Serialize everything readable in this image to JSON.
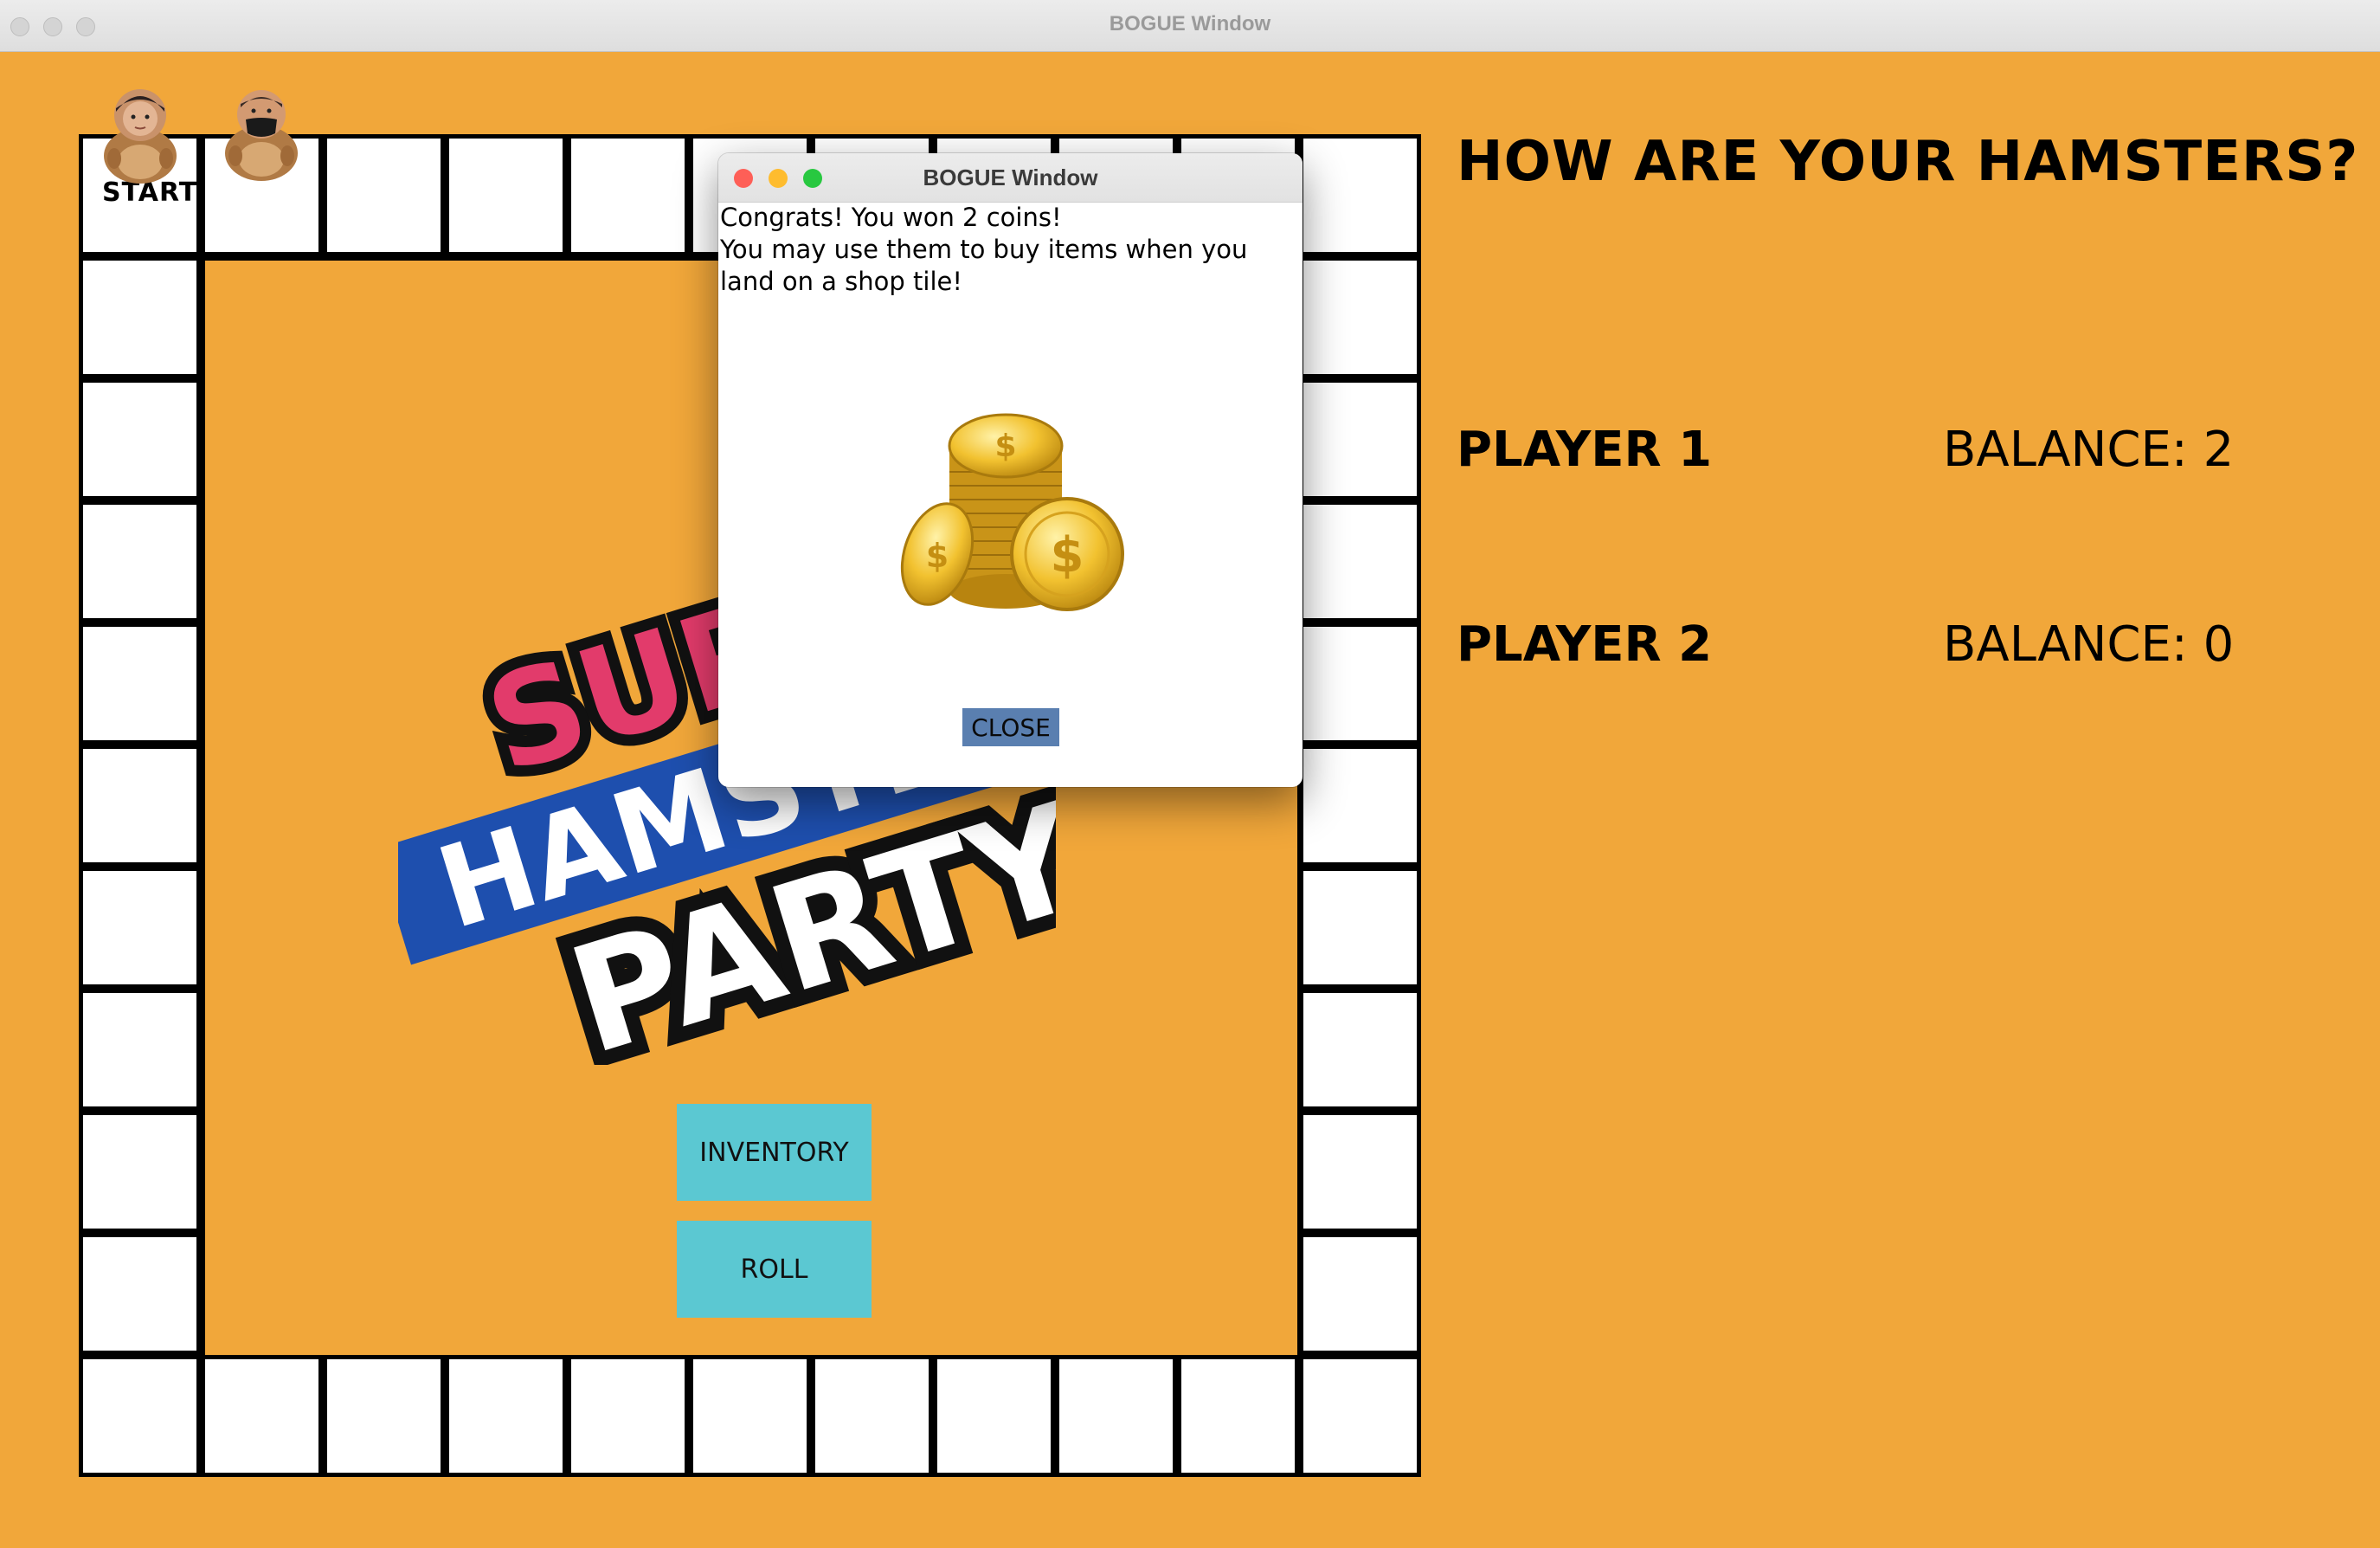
{
  "window": {
    "title": "BOGUE Window"
  },
  "board": {
    "start_label": "START"
  },
  "logo": {
    "line1": "SUPER",
    "line2": "HAMSTER",
    "line3": "PARTY"
  },
  "buttons": {
    "inventory": "INVENTORY",
    "roll": "ROLL"
  },
  "panel": {
    "heading": "HOW ARE YOUR HAMSTERS?",
    "players": [
      {
        "name": "PLAYER 1",
        "balance": "BALANCE: 2"
      },
      {
        "name": "PLAYER 2",
        "balance": "BALANCE: 0"
      }
    ]
  },
  "dialog": {
    "title": "BOGUE Window",
    "message_line1": "Congrats! You won 2 coins!",
    "message_line2": "You may use them to buy items when you land on a shop tile!",
    "close_label": "CLOSE",
    "coin_symbol": "$"
  },
  "colors": {
    "background": "#f1a73a",
    "button": "#5bc8d2",
    "close_button": "#5a7fb0",
    "traffic_red": "#fe5f57",
    "traffic_yellow": "#febc2e",
    "traffic_green": "#28c840"
  },
  "icons": {
    "coins": "coin-stack-icon",
    "player1_token": "hamster-token-icon",
    "player2_token": "hamster-token-icon"
  }
}
